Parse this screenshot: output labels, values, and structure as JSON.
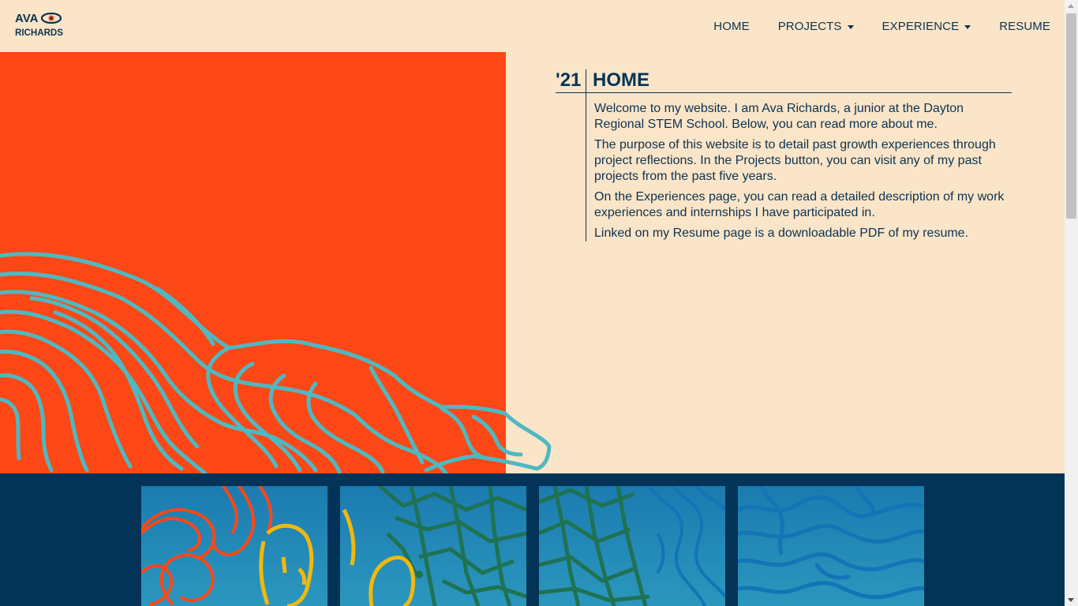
{
  "brand": {
    "line1": "AVA",
    "line2": "RICHARDS",
    "icon": "eye-icon"
  },
  "nav": {
    "items": [
      {
        "label": "HOME",
        "dropdown": false
      },
      {
        "label": "PROJECTS",
        "dropdown": true
      },
      {
        "label": "EXPERIENCE",
        "dropdown": true
      },
      {
        "label": "RESUME",
        "dropdown": false
      }
    ]
  },
  "page": {
    "year": "'21",
    "title": "HOME",
    "paragraphs": [
      "Welcome to my website. I am Ava Richards, a junior at the Dayton Regional STEM School. Below, you can read more about me.",
      "The purpose of this website is to detail past growth experiences through project reflections. In the Projects button, you can visit any of my past projects from the past five years.",
      "On the Experiences page, you can read a detailed description of my work experiences and internships I have participated in.",
      "Linked on my Resume page is a downloadable PDF of my resume."
    ]
  },
  "colors": {
    "cream": "#fae5c9",
    "orange": "#fd4716",
    "navy": "#033457",
    "teal": "#4fb8c0",
    "yellow": "#f2b80d",
    "green": "#1f7252",
    "blue": "#1374b6"
  },
  "gallery": {
    "tiles": 4
  }
}
